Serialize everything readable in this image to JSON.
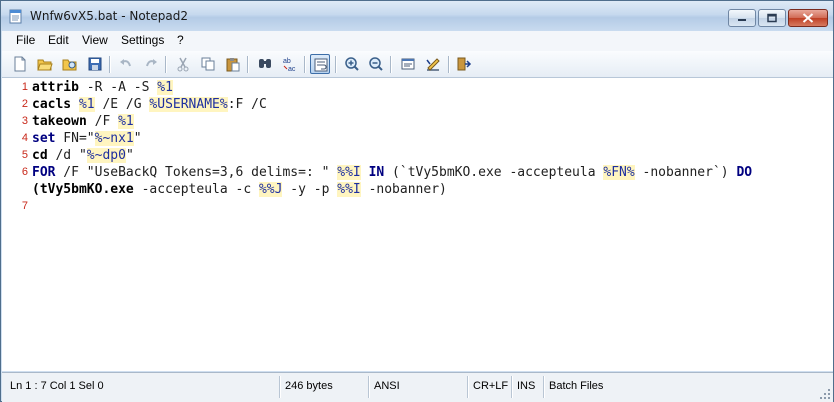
{
  "window": {
    "title": "Wnfw6vX5.bat - Notepad2"
  },
  "menu": {
    "items": [
      {
        "label": "File"
      },
      {
        "label": "Edit"
      },
      {
        "label": "View"
      },
      {
        "label": "Settings"
      },
      {
        "label": "?"
      }
    ]
  },
  "toolbar": {
    "buttons": [
      "new-file-icon",
      "open-file-icon",
      "browse-icon",
      "save-icon",
      "undo-icon",
      "redo-icon",
      "cut-icon",
      "copy-icon",
      "paste-icon",
      "find-icon",
      "replace-icon",
      "word-wrap-icon",
      "zoom-in-icon",
      "zoom-out-icon",
      "scheme-icon",
      "customize-icon",
      "exit-icon"
    ]
  },
  "editor": {
    "line_numbers": [
      "1",
      "2",
      "3",
      "4",
      "5",
      "6",
      "",
      "7"
    ],
    "lines": [
      [
        {
          "t": "attrib",
          "c": "kw-black"
        },
        {
          "t": " -R -A -S ",
          "c": "txt"
        },
        {
          "t": "%1",
          "c": "var"
        }
      ],
      [
        {
          "t": "cacls",
          "c": "kw-black"
        },
        {
          "t": " ",
          "c": "txt"
        },
        {
          "t": "%1",
          "c": "var"
        },
        {
          "t": " /E /G ",
          "c": "txt"
        },
        {
          "t": "%USERNAME%",
          "c": "var"
        },
        {
          "t": ":F /C",
          "c": "txt"
        }
      ],
      [
        {
          "t": "takeown",
          "c": "kw-black"
        },
        {
          "t": " /F ",
          "c": "txt"
        },
        {
          "t": "%1",
          "c": "var"
        }
      ],
      [
        {
          "t": "set",
          "c": "kw"
        },
        {
          "t": " FN=\"",
          "c": "txt"
        },
        {
          "t": "%~nx1",
          "c": "var"
        },
        {
          "t": "\"",
          "c": "txt"
        }
      ],
      [
        {
          "t": "cd",
          "c": "kw-black"
        },
        {
          "t": " /d \"",
          "c": "txt"
        },
        {
          "t": "%~dp0",
          "c": "var"
        },
        {
          "t": "\"",
          "c": "txt"
        }
      ],
      [
        {
          "t": "FOR",
          "c": "kw"
        },
        {
          "t": " /F \"UseBackQ Tokens=3,6 delims=: \" ",
          "c": "txt"
        },
        {
          "t": "%%I",
          "c": "var"
        },
        {
          "t": " ",
          "c": "txt"
        },
        {
          "t": "IN",
          "c": "kw"
        },
        {
          "t": " (`tVy5bmKO.exe -accepteula ",
          "c": "txt"
        },
        {
          "t": "%FN%",
          "c": "var"
        },
        {
          "t": " -nobanner`) ",
          "c": "txt"
        },
        {
          "t": "DO",
          "c": "kw"
        }
      ],
      [
        {
          "t": "(tVy5bmKO.exe",
          "c": "kw-black"
        },
        {
          "t": " -accepteula -c ",
          "c": "txt"
        },
        {
          "t": "%%J",
          "c": "var"
        },
        {
          "t": " -y -p ",
          "c": "txt"
        },
        {
          "t": "%%I",
          "c": "var"
        },
        {
          "t": " -nobanner)",
          "c": "txt"
        }
      ],
      []
    ]
  },
  "status": {
    "position": "Ln 1 : 7   Col 1   Sel 0",
    "size": "246 bytes",
    "encoding": "ANSI",
    "line_endings": "CR+LF",
    "mode": "INS",
    "lexer": "Batch Files"
  },
  "colors": {
    "line_number": "#c8281a",
    "keyword": "#000080",
    "variable_bg": "#fff5c0",
    "variable_fg": "#1e2fa0"
  }
}
